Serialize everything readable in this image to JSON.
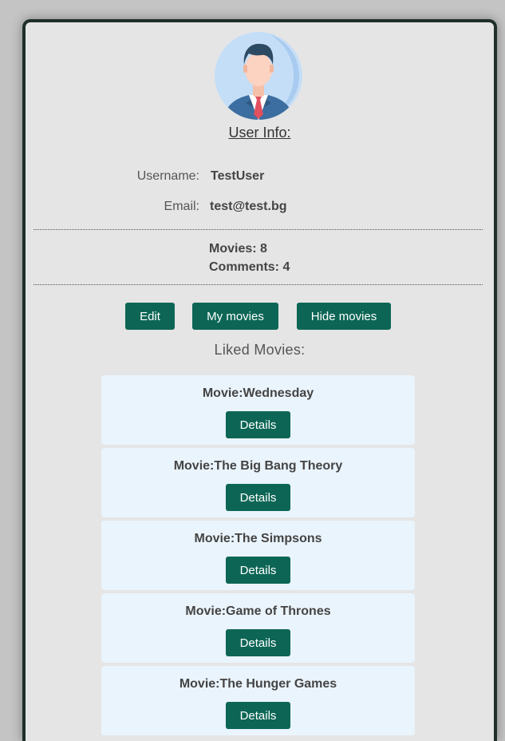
{
  "profile": {
    "title": "User Info:",
    "username_label": "Username:",
    "username_value": "TestUser",
    "email_label": "Email:",
    "email_value": "test@test.bg",
    "movies_count": "Movies: 8",
    "comments_count": "Comments: 4"
  },
  "actions": {
    "edit_label": "Edit",
    "my_movies_label": "My movies",
    "hide_movies_label": "Hide movies"
  },
  "liked": {
    "heading": "Liked Movies:",
    "items": [
      {
        "title": "Movie:Wednesday",
        "button": "Details"
      },
      {
        "title": "Movie:The Big Bang Theory",
        "button": "Details"
      },
      {
        "title": "Movie:The Simpsons",
        "button": "Details"
      },
      {
        "title": "Movie:Game of Thrones",
        "button": "Details"
      },
      {
        "title": "Movie:The Hunger Games",
        "button": "Details"
      }
    ]
  },
  "colors": {
    "accent": "#0d6655",
    "card_background": "#e5e5e5",
    "movie_card_background": "#eaf4fc"
  }
}
